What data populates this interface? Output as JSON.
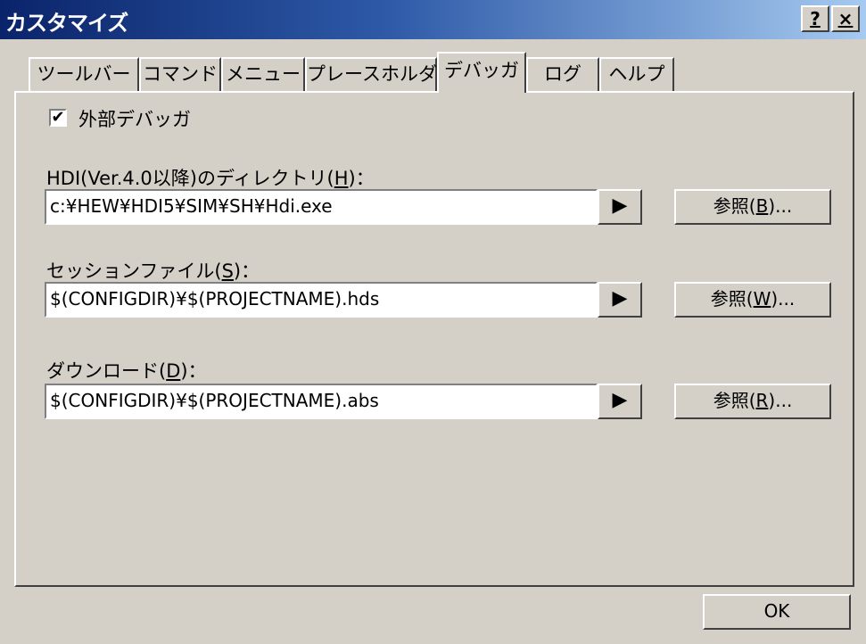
{
  "window": {
    "title": "カスタマイズ",
    "help_label": "?",
    "close_label": "×"
  },
  "tabs": [
    {
      "label": "ツールバー"
    },
    {
      "label": "コマンド"
    },
    {
      "label": "メニュー"
    },
    {
      "label": "プレースホルダ"
    },
    {
      "label": "デバッガ",
      "active": true
    },
    {
      "label": "ログ"
    },
    {
      "label": "ヘルプ"
    }
  ],
  "debugger": {
    "external_checkbox": {
      "label": "外部デバッガ",
      "checked": true,
      "mark": "✔"
    },
    "hdi": {
      "label_prefix": "HDI(Ver.4.0以降)のディレクトリ(",
      "mnemonic": "H",
      "label_suffix": ")：",
      "value": "c:¥HEW¥HDI5¥SIM¥SH¥Hdi.exe",
      "browse_prefix": "参照(",
      "browse_mnemonic": "B",
      "browse_suffix": ")..."
    },
    "session": {
      "label_prefix": "セッションファイル(",
      "mnemonic": "S",
      "label_suffix": ")：",
      "value": "$(CONFIGDIR)¥$(PROJECTNAME).hds",
      "browse_prefix": "参照(",
      "browse_mnemonic": "W",
      "browse_suffix": ")..."
    },
    "download": {
      "label_prefix": "ダウンロード(",
      "mnemonic": "D",
      "label_suffix": ")：",
      "value": "$(CONFIGDIR)¥$(PROJECTNAME).abs",
      "browse_prefix": "参照(",
      "browse_mnemonic": "R",
      "browse_suffix": ")..."
    },
    "arrow_glyph": "▶"
  },
  "footer": {
    "ok_label": "OK"
  }
}
